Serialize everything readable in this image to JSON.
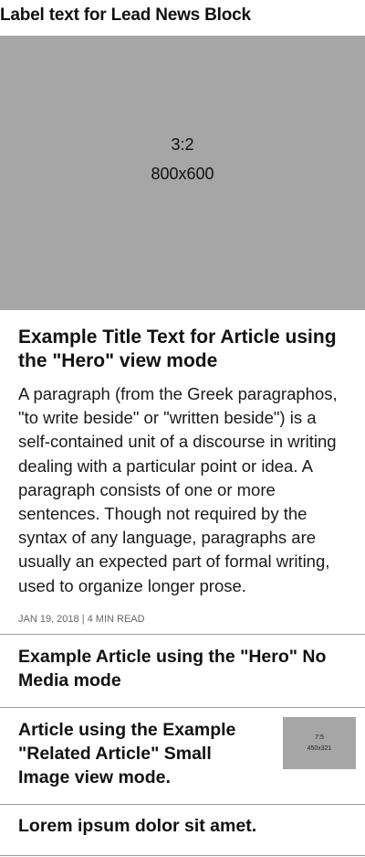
{
  "block": {
    "label": "Label text for Lead News Block"
  },
  "hero": {
    "image": {
      "ratio": "3:2",
      "size": "800x600"
    },
    "title": "Example Title Text for Article using the \"Hero\" view mode",
    "body": "A paragraph (from the Greek paragraphos, \"to write beside\" or \"written beside\") is a self-contained unit of a discourse in writing dealing with a particular point or idea. A paragraph consists of one or more sentences. Though not required by the syntax of any language, paragraphs are usually an expected part of formal writing, used to organize longer prose.",
    "meta": "JAN 19, 2018 | 4 MIN READ"
  },
  "articles": [
    {
      "title": "Example Article using the \"Hero\" No Media mode"
    },
    {
      "title": "Article using the Example \"Related Article\" Small Image view mode.",
      "thumb": {
        "ratio": "7:5",
        "size": "450x321"
      }
    },
    {
      "title": "Lorem ipsum dolor sit amet."
    }
  ]
}
